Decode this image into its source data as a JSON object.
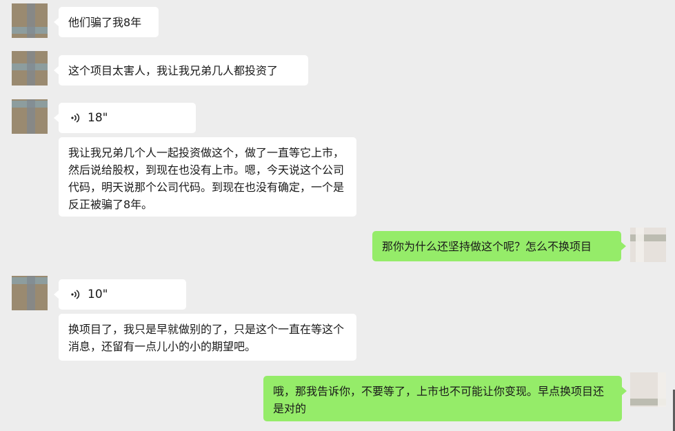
{
  "chat": {
    "messages": [
      {
        "side": "left",
        "type": "text",
        "text": "他们骗了我8年"
      },
      {
        "side": "left",
        "type": "text",
        "text": "这个项目太害人，我让我兄弟几人都投资了"
      },
      {
        "side": "left",
        "type": "voice",
        "duration": "18\""
      },
      {
        "side": "left",
        "type": "text",
        "text": "我让我兄弟几个人一起投资做这个，做了一直等它上市，然后说给股权，到现在也没有上市。嗯，今天说这个公司代码，明天说那个公司代码。到现在也没有确定，一个是反正被骗了8年。"
      },
      {
        "side": "right",
        "type": "text",
        "text": "那你为什么还坚持做这个呢？怎么不换项目"
      },
      {
        "side": "left",
        "type": "voice",
        "duration": "10\""
      },
      {
        "side": "left",
        "type": "text",
        "text": "换项目了，我只是早就做别的了，只是这个一直在等这个消息，还留有一点儿小的小的期望吧。"
      },
      {
        "side": "right",
        "type": "text",
        "text": "哦，那我告诉你，不要等了，上市也不可能让你变现。早点换项目还是对的"
      }
    ]
  },
  "colors": {
    "background": "#ededed",
    "incoming_bubble": "#ffffff",
    "outgoing_bubble": "#95ec69"
  },
  "icons": {
    "voice": "voice-wave-icon",
    "avatar_contact": "avatar-contact",
    "avatar_self": "avatar-self"
  }
}
